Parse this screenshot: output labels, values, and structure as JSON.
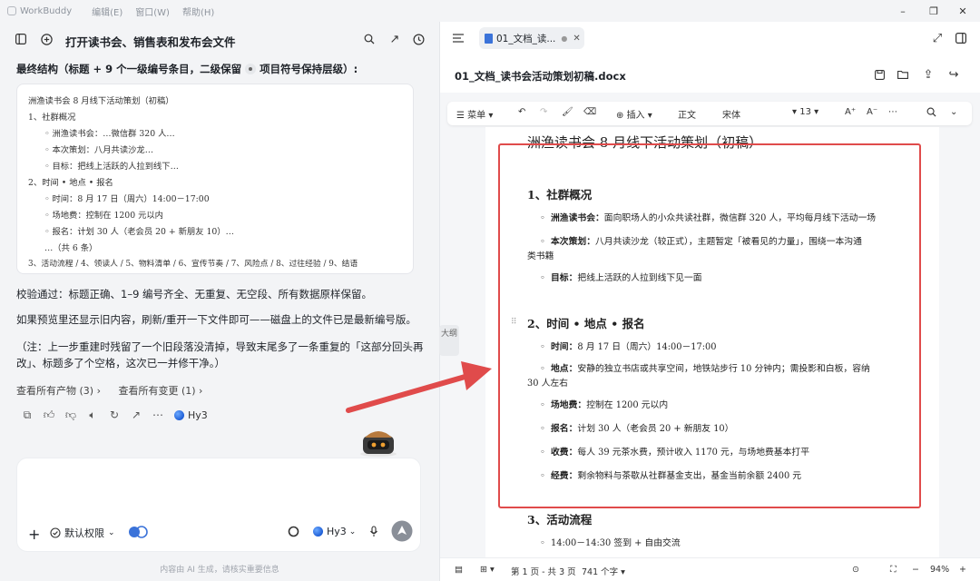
{
  "app": {
    "name": "WorkBuddy",
    "menus": [
      "编辑(E)",
      "窗口(W)",
      "帮助(H)"
    ]
  },
  "chat": {
    "title": "打开读书会、销售表和发布会文件",
    "structure_label_a": "最终结构（标题 + 9 个一级编号条目，二级保留",
    "structure_label_b": "项目符号保持层级）:",
    "code_lines": [
      "洲渔读书会 8 月线下活动策划（初稿）",
      "1、社群概况",
      "◦ 洲渔读书会：…微信群 320 人…",
      "◦ 本次策划：八月共读沙龙…",
      "◦ 目标：把线上活跃的人拉到线下…",
      "2、时间 • 地点 • 报名",
      "◦ 时间：8 月 17 日（周六）14:00－17:00",
      "◦ 场地费：控制在 1200 元以内",
      "◦ 报名：计划 30 人（老会员 20 + 新朋友 10）…",
      "…（共 6 条）",
      "3、活动流程 / 4、领读人 / 5、物料清单 / 6、宣传节奏 / 7、风险点 / 8、过往经验 / 9、结语"
    ],
    "verify": "校验通过：标题正确、1–9 编号齐全、无重复、无空段、所有数据原样保留。",
    "refresh": "如果预览里还显示旧内容，刷新/重开一下文件即可——磁盘上的文件已是最新编号版。",
    "note_line1": "（注：上一步重建时残留了一个旧段落没清掉，导致末尾多了一条重复的「这部分回头再",
    "note_line2": "改」、标题多了个空格，这次已一并修干净。）",
    "link_artifacts": "查看所有产物 (3) ›",
    "link_changes": "查看所有变更 (1) ›",
    "model_tag": "Hy3",
    "permission": "默认权限",
    "model_select": "Hy3",
    "footnote": "内容由 AI 生成，请核实重要信息"
  },
  "doc": {
    "tab_label": "01_文档_读...",
    "filename": "01_文档_读书会活动策划初稿.docx",
    "toolbar": {
      "menu": "菜单",
      "insert": "插入",
      "style": "正文",
      "font": "宋体",
      "size": "13"
    },
    "side_tab": "大纲",
    "title": "洲渔读书会 8 月线下活动策划（初稿）",
    "sec1": "1、社群概况",
    "sec1_items": [
      {
        "k": "洲渔读书会：",
        "v": "面向职场人的小众共读社群，微信群 320 人，平均每月线下活动一场"
      },
      {
        "k": "本次策划：",
        "v": "八月共读沙龙（较正式），主题暂定「被看见的力量」，围绕一本沟通",
        "cont": "类书籍"
      },
      {
        "k": "目标：",
        "v": "把线上活跃的人拉到线下见一面"
      }
    ],
    "sec2": "2、时间 • 地点 • 报名",
    "sec2_items": [
      {
        "k": "时间：",
        "v": "8 月 17 日（周六）14:00－17:00"
      },
      {
        "k": "地点：",
        "v": "安静的独立书店或共享空间，地铁站步行 10 分钟内；需投影和白板，容纳",
        "cont": "30 人左右"
      },
      {
        "k": "场地费：",
        "v": "控制在 1200 元以内"
      },
      {
        "k": "报名：",
        "v": "计划 30 人（老会员 20 + 新朋友 10）"
      },
      {
        "k": "收费：",
        "v": "每人 39 元茶水费，预计收入 1170 元，与场地费基本打平"
      },
      {
        "k": "经费：",
        "v": "剩余物料与茶歇从社群基金支出，基金当前余额 2400 元"
      }
    ],
    "sec3": "3、活动流程",
    "sec3_items": [
      {
        "v": "14:00－14:30 签到 + 自由交流"
      }
    ],
    "status": {
      "page": "第 1 页 - 共 3 页",
      "words": "741 个字",
      "zoom": "94%"
    }
  },
  "colors": {
    "highlight_box": "#e04b4b",
    "arrow": "#e04b4b",
    "accent": "#3b73d9"
  }
}
